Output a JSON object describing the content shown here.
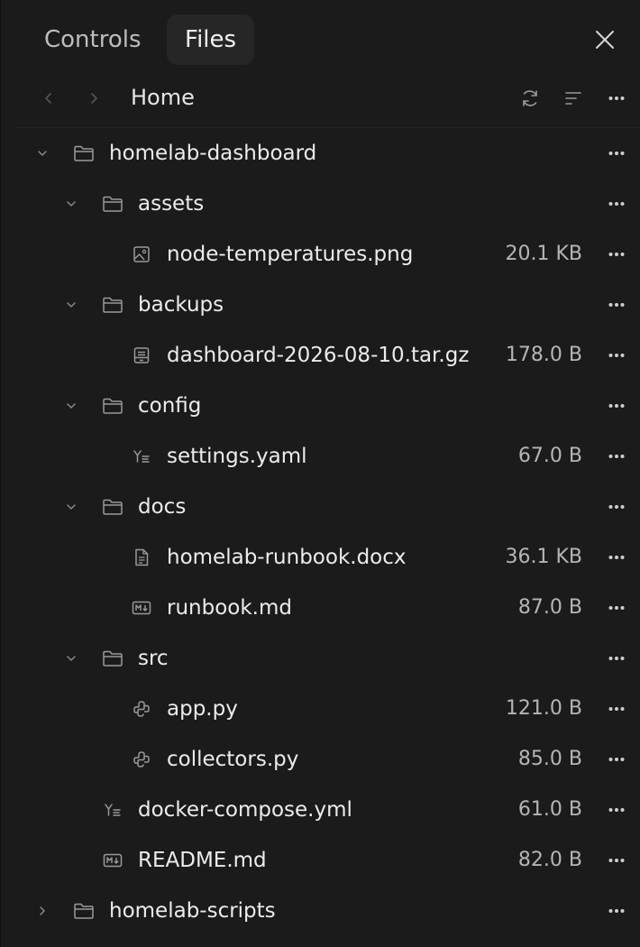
{
  "tabs": {
    "controls": "Controls",
    "files": "Files",
    "active": "Files"
  },
  "nav": {
    "breadcrumb": "Home"
  },
  "tree": [
    {
      "name": "homelab-dashboard",
      "kind": "folder",
      "depth": 0,
      "expanded": true,
      "size": ""
    },
    {
      "name": "assets",
      "kind": "folder",
      "depth": 1,
      "expanded": true,
      "size": ""
    },
    {
      "name": "node-temperatures.png",
      "kind": "image",
      "depth": 2,
      "size": "20.1 KB"
    },
    {
      "name": "backups",
      "kind": "folder",
      "depth": 1,
      "expanded": true,
      "size": ""
    },
    {
      "name": "dashboard-2026-08-10.tar.gz",
      "kind": "archive",
      "depth": 2,
      "size": "178.0 B"
    },
    {
      "name": "config",
      "kind": "folder",
      "depth": 1,
      "expanded": true,
      "size": ""
    },
    {
      "name": "settings.yaml",
      "kind": "yaml",
      "depth": 2,
      "size": "67.0 B"
    },
    {
      "name": "docs",
      "kind": "folder",
      "depth": 1,
      "expanded": true,
      "size": ""
    },
    {
      "name": "homelab-runbook.docx",
      "kind": "document",
      "depth": 2,
      "size": "36.1 KB"
    },
    {
      "name": "runbook.md",
      "kind": "markdown",
      "depth": 2,
      "size": "87.0 B"
    },
    {
      "name": "src",
      "kind": "folder",
      "depth": 1,
      "expanded": true,
      "size": ""
    },
    {
      "name": "app.py",
      "kind": "python",
      "depth": 2,
      "size": "121.0 B"
    },
    {
      "name": "collectors.py",
      "kind": "python",
      "depth": 2,
      "size": "85.0 B"
    },
    {
      "name": "docker-compose.yml",
      "kind": "yaml",
      "depth": 1,
      "size": "61.0 B"
    },
    {
      "name": "README.md",
      "kind": "markdown",
      "depth": 1,
      "size": "82.0 B"
    },
    {
      "name": "homelab-scripts",
      "kind": "folder",
      "depth": 0,
      "expanded": false,
      "size": ""
    }
  ],
  "colors": {
    "background": "#1b1b1b",
    "active_tab": "#262626",
    "text": "#ececec",
    "muted": "#b5b5b5",
    "icon": "#9a9a9a"
  }
}
